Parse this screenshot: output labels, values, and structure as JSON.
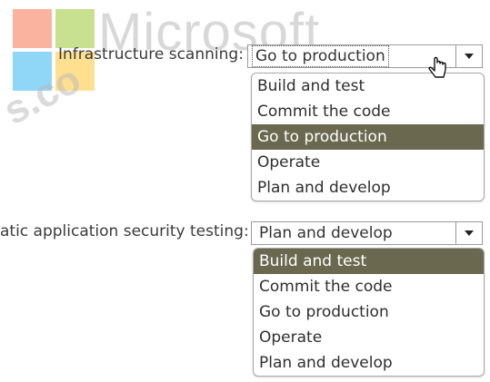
{
  "watermark": {
    "brand_text": "Microsoft",
    "side_text": "s.co",
    "logo_colors": [
      "#f25022",
      "#7fba00",
      "#00a4ef",
      "#ffb900"
    ]
  },
  "question1": {
    "label": "Infrastructure scanning:",
    "selected_value": "Go to production",
    "options": [
      "Build and test",
      "Commit the code",
      "Go to production",
      "Operate",
      "Plan and develop"
    ],
    "highlighted_option": "Go to production"
  },
  "question2": {
    "label": "atic application security testing:",
    "selected_value": "Plan and develop",
    "options": [
      "Build and test",
      "Commit the code",
      "Go to production",
      "Operate",
      "Plan and develop"
    ],
    "highlighted_option": "Build and test"
  },
  "colors": {
    "highlight_bg": "#6b6850",
    "highlight_text": "#ffffff"
  }
}
